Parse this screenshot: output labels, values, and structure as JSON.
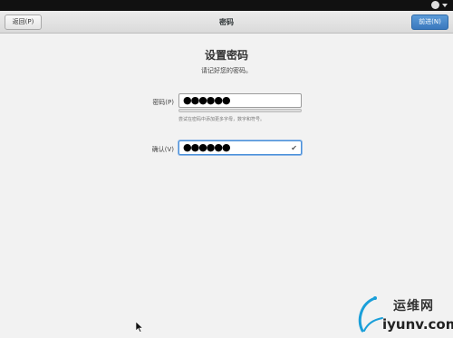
{
  "topbar": {
    "status_icon": "user-status-icon"
  },
  "header": {
    "back_label": "返回(P)",
    "title": "密码",
    "next_label": "前进(N)"
  },
  "main": {
    "title": "设置密码",
    "subtitle": "请记好您的密码。",
    "password": {
      "label": "密码(P)",
      "value": "●●●●●●"
    },
    "strength_hint": "尝试在密码中添加更多字母，数字和符号。",
    "confirm": {
      "label": "确认(V)",
      "value": "●●●●●●",
      "status_icon": "check-icon"
    }
  },
  "watermark": {
    "name": "运维网",
    "url": "iyunv.com"
  },
  "colors": {
    "accent": "#3a78bd",
    "focus": "#4a90d9",
    "logo": "#1a9fd9"
  }
}
